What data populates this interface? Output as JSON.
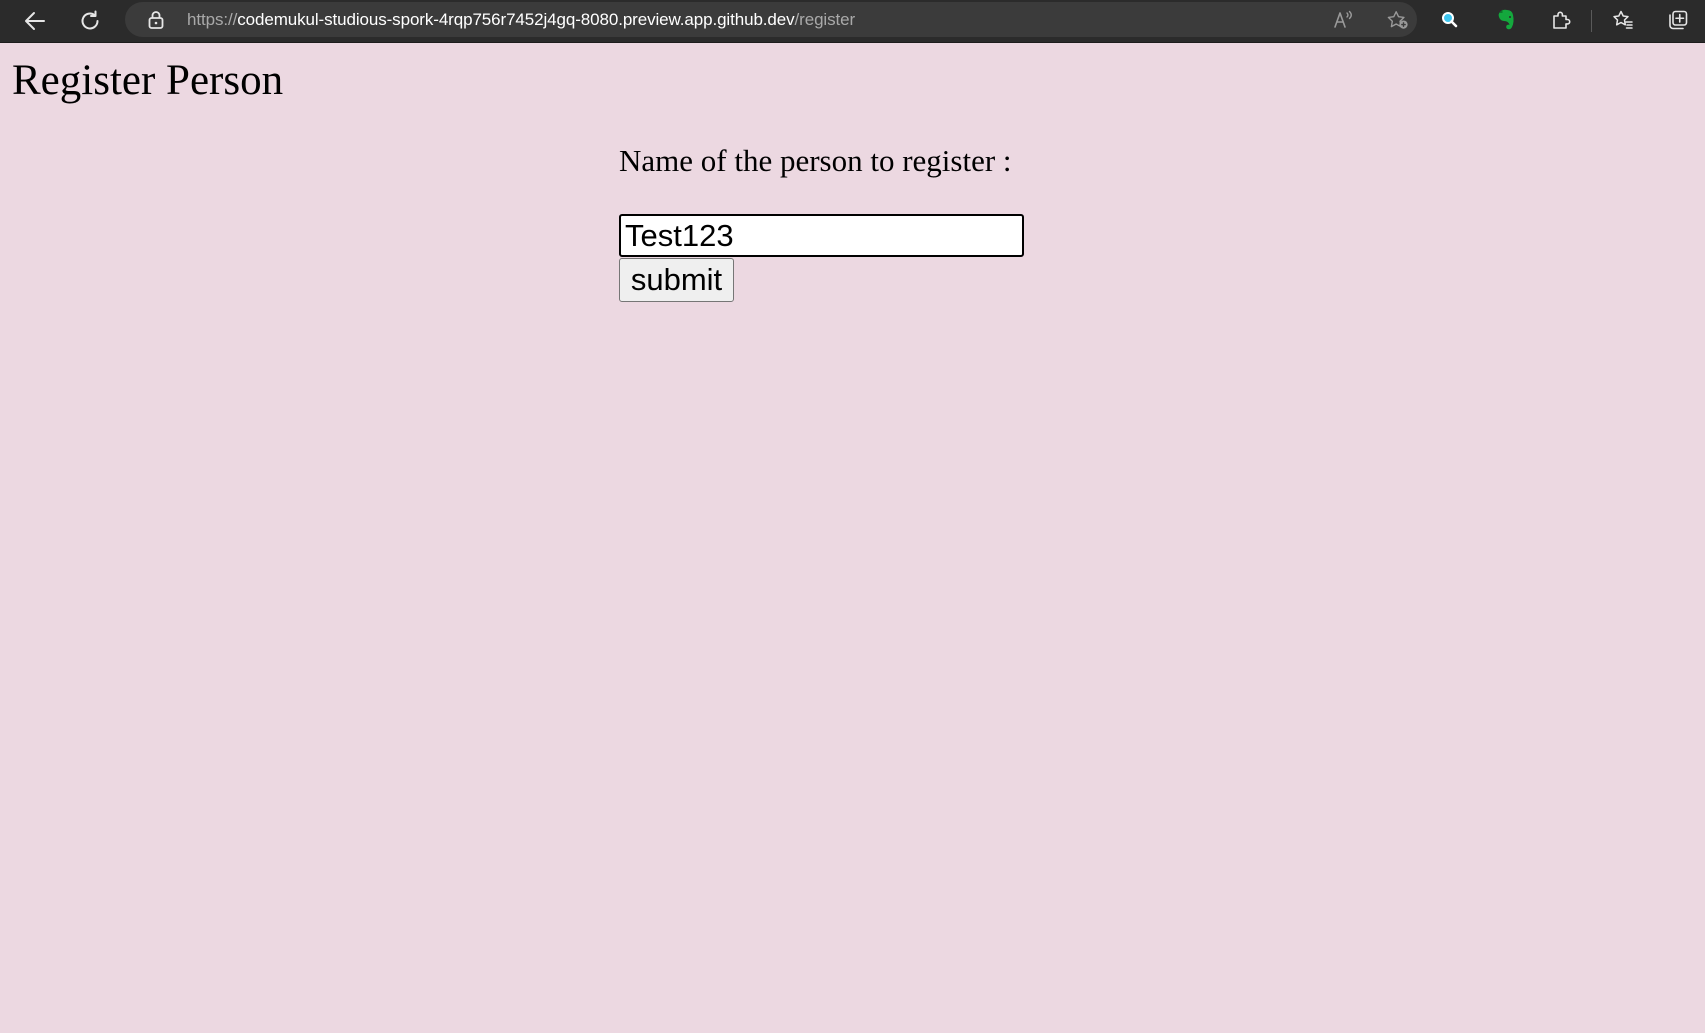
{
  "browser": {
    "url": {
      "scheme": "https://",
      "host": "codemukul-studious-spork-4rqp756r7452j4gq-8080.preview.app.github.dev",
      "path": "/register"
    },
    "icons": {
      "back": "back-arrow-icon",
      "reload": "reload-icon",
      "lock": "lock-icon",
      "read_aloud": "read-aloud-icon",
      "add_favorite": "star-add-icon",
      "extension_search": "search-icon",
      "extension_evernote": "evernote-icon",
      "extensions": "puzzle-icon",
      "favorites": "favorites-icon",
      "collections": "collections-icon"
    },
    "colors": {
      "chrome_background": "#2b2b2b",
      "address_background": "#3b3b3b",
      "evernote_green": "#14a83d",
      "search_cyan": "#3ec6f0"
    }
  },
  "page": {
    "title": "Register Person",
    "background": "#ecd8e1",
    "form": {
      "label": "Name of the person to register :",
      "name_value": "Test123",
      "submit_label": "submit"
    }
  }
}
